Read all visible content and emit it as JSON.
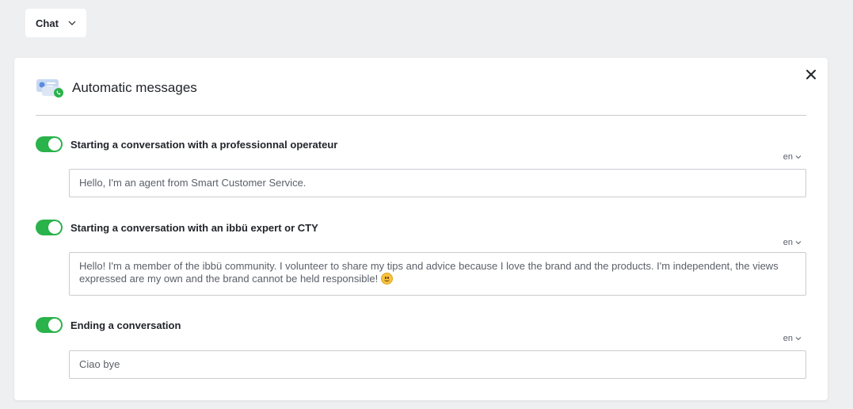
{
  "top": {
    "channel_select": "Chat"
  },
  "panel": {
    "title": "Automatic messages",
    "sections": [
      {
        "label": "Starting a conversation with a professionnal operateur",
        "enabled": true,
        "lang": "en",
        "message": "Hello, I'm an agent from Smart Customer Service."
      },
      {
        "label": "Starting a conversation with an ibbü expert or CTY",
        "enabled": true,
        "lang": "en",
        "message": "Hello! I'm a member of the ibbü community. I volunteer to share my tips and advice because I love the brand and the products. I'm independent, the views expressed are my own and the brand cannot be held responsible!"
      },
      {
        "label": "Ending a conversation",
        "enabled": true,
        "lang": "en",
        "message": "Ciao bye"
      }
    ]
  },
  "colors": {
    "toggle_on": "#2ab24b",
    "background": "#eeeff1",
    "panel": "#ffffff"
  },
  "icons": [
    "chevron-down-icon",
    "close-icon",
    "chat-bubbles-icon",
    "smiley-emoji-icon"
  ]
}
